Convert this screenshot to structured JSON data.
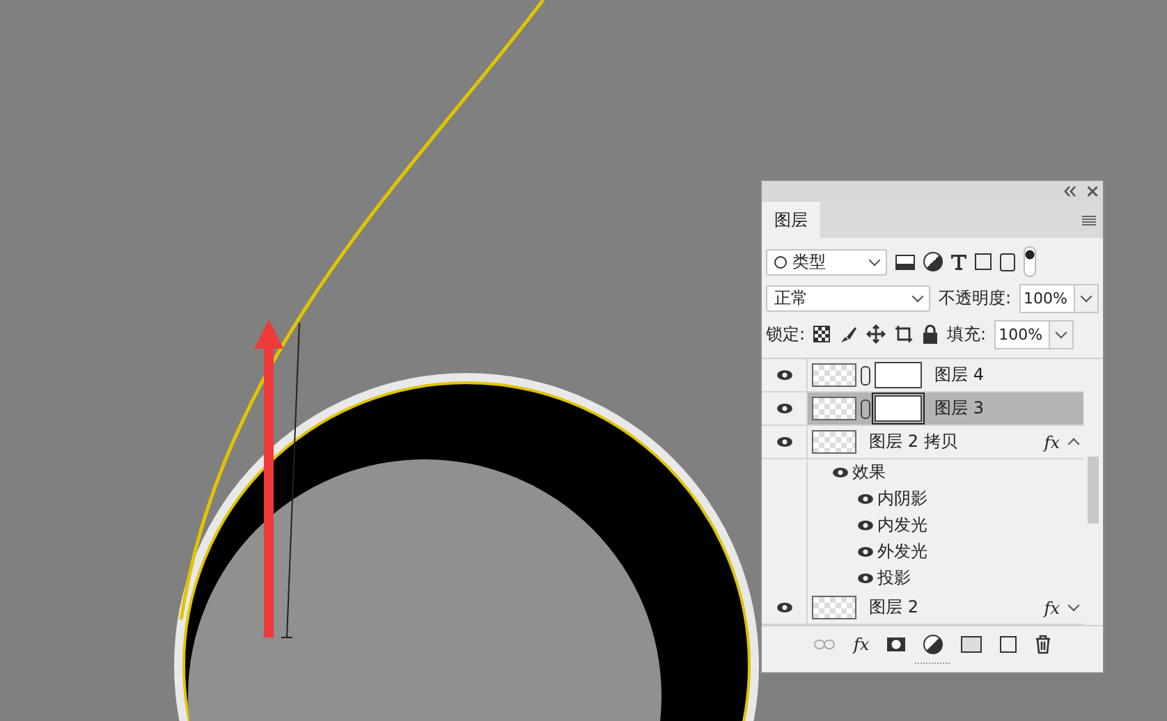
{
  "panel": {
    "tabs": [
      {
        "label": "图层",
        "selected": true
      }
    ],
    "filter": {
      "value": "类型"
    },
    "blend": {
      "value": "正常"
    },
    "opacity": {
      "label": "不透明度:",
      "value": "100%"
    },
    "lock": {
      "label": "锁定:"
    },
    "fill": {
      "label": "填充:",
      "value": "100%"
    },
    "layers": [
      {
        "name": "图层 4",
        "visible": true,
        "selected": false,
        "mask": true
      },
      {
        "name": "图层 3",
        "visible": true,
        "selected": true,
        "mask": true
      },
      {
        "name": "图层 2 拷贝",
        "visible": true,
        "selected": false,
        "fx": "fx",
        "expanded": true,
        "children": [
          {
            "name": "效果",
            "visible": true,
            "children": [
              {
                "name": "内阴影",
                "visible": true
              },
              {
                "name": "内发光",
                "visible": true
              },
              {
                "name": "外发光",
                "visible": true
              },
              {
                "name": "投影",
                "visible": true
              }
            ]
          }
        ]
      },
      {
        "name": "图层 2",
        "visible": true,
        "selected": false,
        "fx": "fx",
        "expanded": false
      }
    ],
    "footer": {
      "fx": "fx"
    }
  }
}
